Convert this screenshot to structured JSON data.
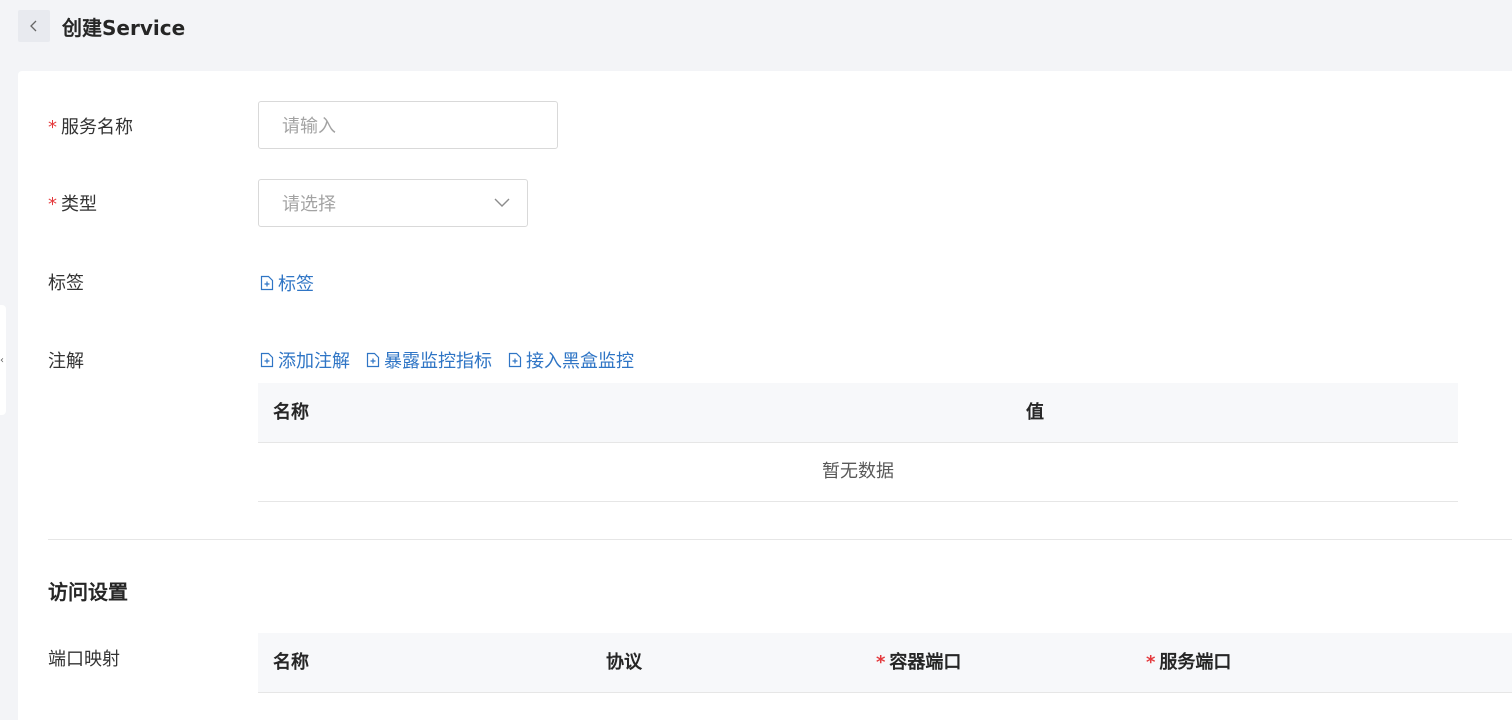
{
  "header": {
    "title": "创建Service",
    "back_icon": "chevron-left-icon"
  },
  "form": {
    "service_name": {
      "label": "服务名称",
      "required": true,
      "placeholder": "请输入"
    },
    "type": {
      "label": "类型",
      "required": true,
      "placeholder": "请选择"
    },
    "labels": {
      "label": "标签",
      "add_link": "标签"
    },
    "annotations": {
      "label": "注解",
      "links": [
        "添加注解",
        "暴露监控指标",
        "接入黑盒监控"
      ],
      "table": {
        "columns": [
          "名称",
          "值"
        ],
        "empty_text": "暂无数据"
      }
    }
  },
  "access": {
    "section_title": "访问设置",
    "port_mapping": {
      "label": "端口映射",
      "columns": [
        {
          "label": "名称",
          "required": false
        },
        {
          "label": "协议",
          "required": false
        },
        {
          "label": "容器端口",
          "required": true
        },
        {
          "label": "服务端口",
          "required": true
        }
      ]
    }
  },
  "colors": {
    "link": "#2f75c5",
    "required": "#e4393c",
    "background": "#f3f4f7"
  }
}
